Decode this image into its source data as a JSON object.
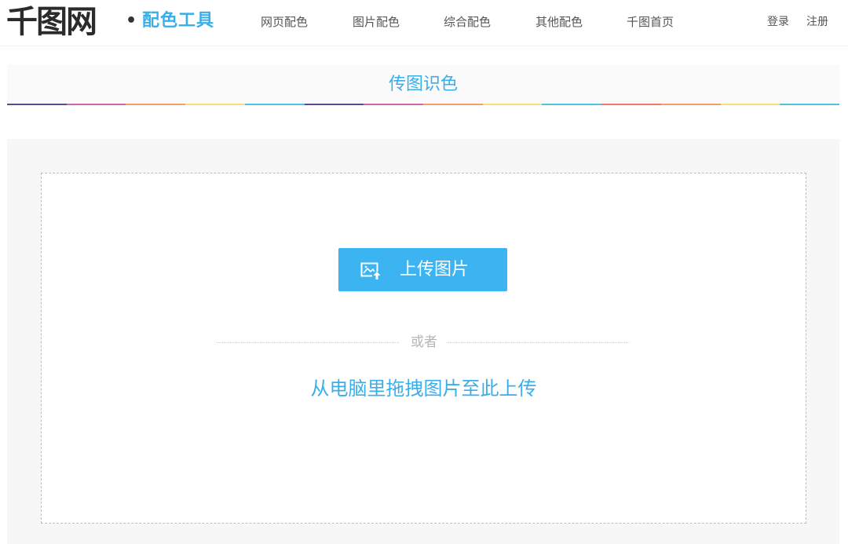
{
  "header": {
    "logo_main": "千图网",
    "logo_dot": "•",
    "logo_sub": "配色工具",
    "nav": [
      {
        "label": "网页配色"
      },
      {
        "label": "图片配色"
      },
      {
        "label": "综合配色"
      },
      {
        "label": "其他配色"
      },
      {
        "label": "千图首页"
      }
    ],
    "login": "登录",
    "register": "注册"
  },
  "section": {
    "title": "传图识色",
    "stripe_colors": [
      "#5b4a8a",
      "#c86aa8",
      "#f0a070",
      "#f7e07a",
      "#4fc3e0",
      "#5b4a8a",
      "#c86aa8",
      "#f0a070",
      "#f7e07a",
      "#4fc3e0",
      "#f07a6a",
      "#f0a070",
      "#f7e07a",
      "#4fc3e0"
    ]
  },
  "upload": {
    "icon": "image-upload-icon",
    "button_label": "上传图片",
    "or_text": "或者",
    "drag_hint": "从电脑里拖拽图片至此上传"
  },
  "colors": {
    "accent": "#3aaee8",
    "button": "#3db4f2"
  }
}
